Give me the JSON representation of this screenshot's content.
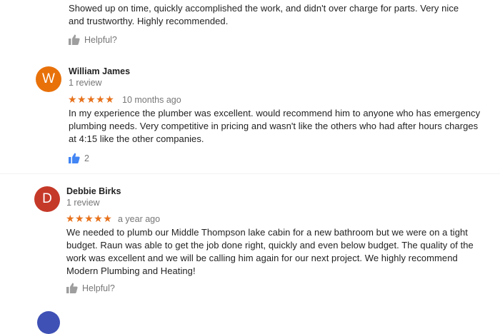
{
  "reviews": [
    {
      "text": "Showed up on time, quickly accomplished the work, and didn't over charge for parts.  Very nice and trustworthy.  Highly recommended.",
      "helpful_label": "Helpful?"
    },
    {
      "initial": "W",
      "name": "William James",
      "count": "1 review",
      "stars": "★★★★★",
      "rating": 5,
      "time": "10 months ago",
      "text": "In my experience the plumber was excellent. would recommend him to anyone who has emergency plumbing needs. Very competitive in pricing and wasn't like the others who had after hours charges at 4:15 like the other companies.",
      "helpful_count": "2",
      "avatar_color": "#e8710a"
    },
    {
      "initial": "D",
      "name": "Debbie Birks",
      "count": "1 review",
      "stars": "★★★★★",
      "rating": 5,
      "time": "a year ago",
      "text": "We needed to plumb our Middle Thompson lake cabin for a new bathroom but we were on a tight budget.  Raun was able to get the job done right, quickly and even below budget.  The quality of the work was excellent and we will be calling him again for our next project.  We highly recommend Modern Plumbing and Heating!",
      "helpful_label": "Helpful?",
      "avatar_color": "#c53929"
    }
  ],
  "colors": {
    "star": "#e7711b",
    "thumb_inactive": "#9e9e9e",
    "thumb_active": "#4285f4"
  }
}
